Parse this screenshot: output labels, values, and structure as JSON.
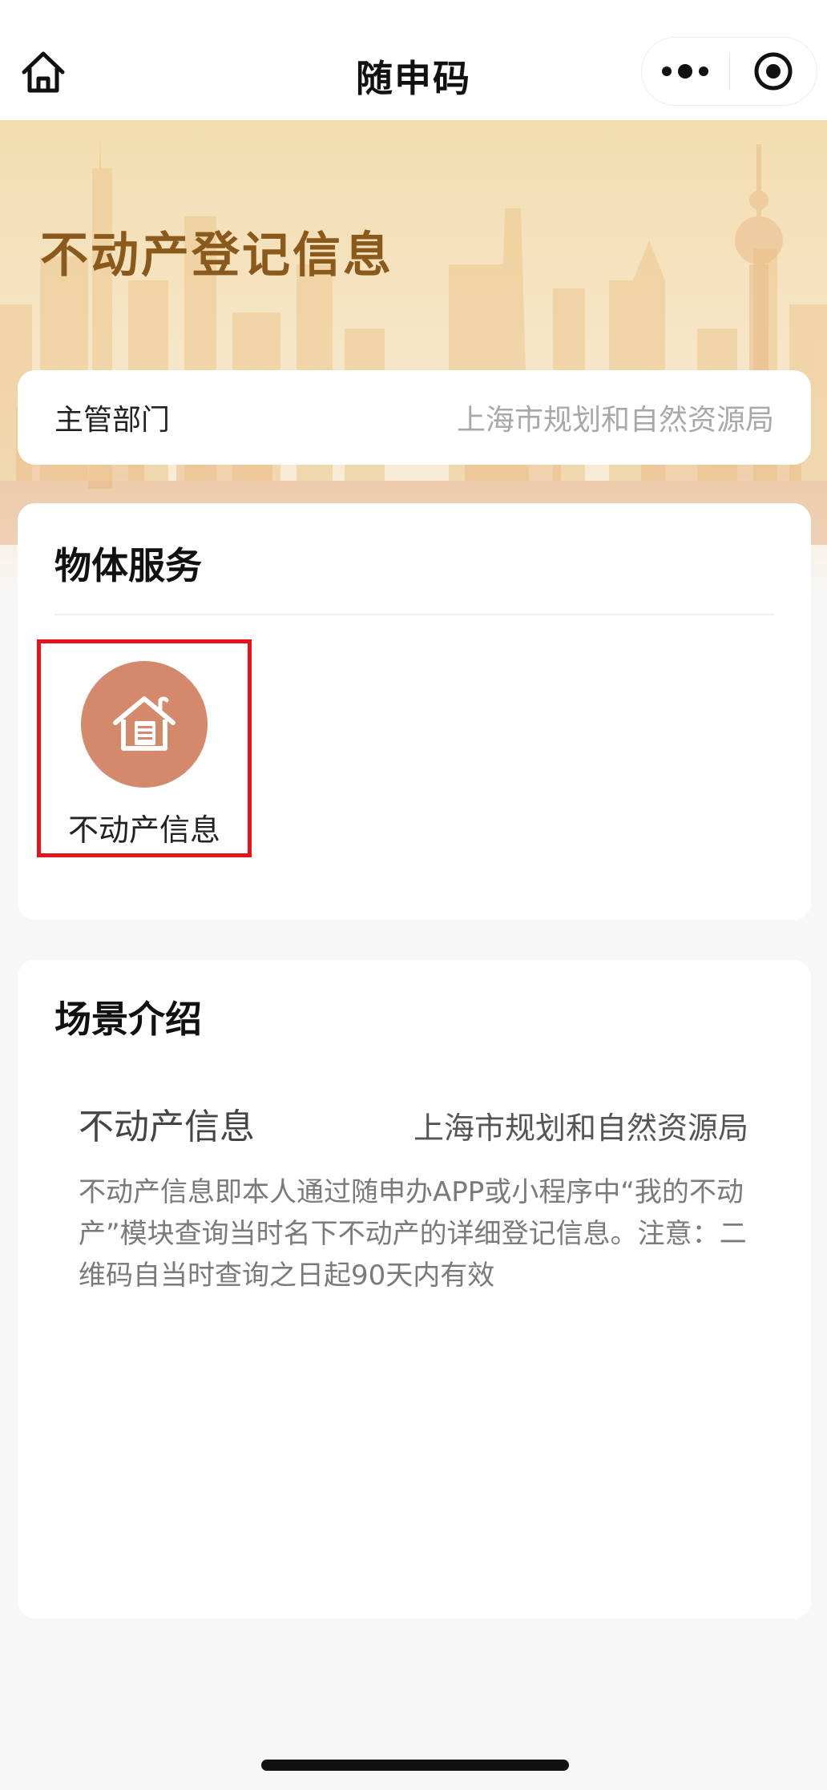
{
  "navbar": {
    "title": "随申码",
    "home_icon": "home-icon",
    "more_icon": "more-dots-icon",
    "target_icon": "target-icon"
  },
  "banner": {
    "title": "不动产登记信息"
  },
  "department": {
    "label": "主管部门",
    "value": "上海市规划和自然资源局"
  },
  "services": {
    "title": "物体服务",
    "items": [
      {
        "label": "不动产信息",
        "icon": "house-document-icon",
        "icon_color": "#d4896b",
        "highlight_color": "#e3141b"
      }
    ]
  },
  "scene": {
    "title": "场景介绍",
    "name": "不动产信息",
    "department": "上海市规划和自然资源局",
    "description": "不动产信息即本人通过随申办APP或小程序中“我的不动产”模块查询当时名下不动产的详细登记信息。注意：二维码自当时查询之日起90天内有效"
  },
  "colors": {
    "banner_title": "#8a5a1c",
    "page_background": "#f7f7f7"
  }
}
